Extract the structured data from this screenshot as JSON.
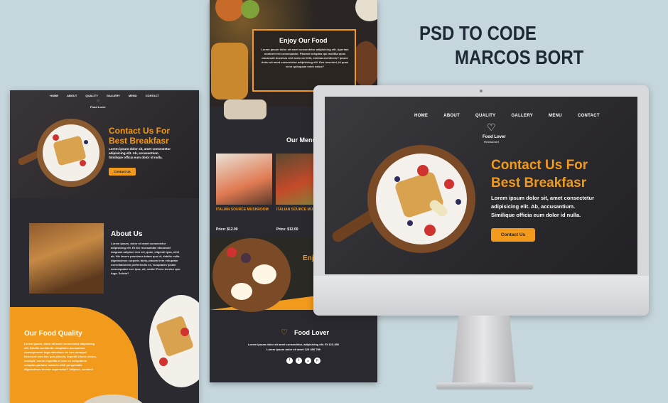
{
  "headline": {
    "line1": "PSD TO CODE",
    "line2": "MARCOS BORT"
  },
  "nav": [
    "HOME",
    "ABOUT",
    "QUALITY",
    "GALLERY",
    "MENU",
    "CONTACT"
  ],
  "brand": {
    "name": "Food Lover",
    "sub": "Restaurant"
  },
  "hero": {
    "title1": "Contact Us For",
    "title2": "Best Breakfasr",
    "line1": "Lorem ipsum dolor sit, amet consectetur",
    "line2": "adipisicing elit. Ab, accusantium.",
    "line3": "Similique officia eum dolor id nulla.",
    "button": "Contact Us"
  },
  "about": {
    "title": "About Us",
    "text": "Lorem ipsum, dolor sit amet consectetur adipisicing elit. Et illo recusandae obcaecati magnam adipisci rem vel, quae, eligendi ipsa, nihil ab. Hic facere possimus totam quo id, debitis nulla dignissimos corporis dicta, placeat rem voluptate exercitationem perferendis ex, voluptates ipsam consequatur iure ipsa, sit, nobis! Porro tenetur quo fuga. Soluta?"
  },
  "quality": {
    "title": "Our Food Quality",
    "text": "Lorem ipsum, dolor sit amet consectetur adipisicing elit. Debitis architecto voluptates accusamus consequuntur fuga doloribus vel iure cumque! Deserunt cum iste quo placeat, impedit Libero minus, suscipit, omnis expedita et eius ex voluptatem voluptas pariatur maiores nihil perspiciatis dignissimos tenetur aspernatur? Adipisci, veniam?"
  },
  "enjoy": {
    "title": "Enjoy Our Food",
    "text": "Lorem ipsum dolor sit amet consectetur adipisicing elit. Aperiam nostrum est consequatur. Placeat voluptas qui mollitia quos obcaecati ducimus sint iusto ea Velit, minima architecto? Ipsum dolor sit amet consectetur adipisicing elit. Eos nesciunt, id quae error quisquam enim natus?"
  },
  "menu": {
    "title": "Our Menu",
    "items": [
      {
        "name": "ITALIAN SOURCE MUSHROOM",
        "price": "Price: $12.00"
      },
      {
        "name": "ITALIAN SOURCE MUSHROOM",
        "price": "Price: $12.00"
      }
    ]
  },
  "enjoy2": {
    "title": "Enjoy"
  },
  "footer": {
    "brand": "Food Lover",
    "line1": "Lorem ipsum dolor sit amet consectetur, adipisicing elit. Et 123-456",
    "line2": "Lorem ipsum dolor sit amet 123 456 789",
    "social": [
      "f",
      "t",
      "in",
      "p"
    ]
  },
  "colors": {
    "accent": "#f29a1b",
    "dark": "#29292f",
    "bg": "#c5d6dc"
  }
}
